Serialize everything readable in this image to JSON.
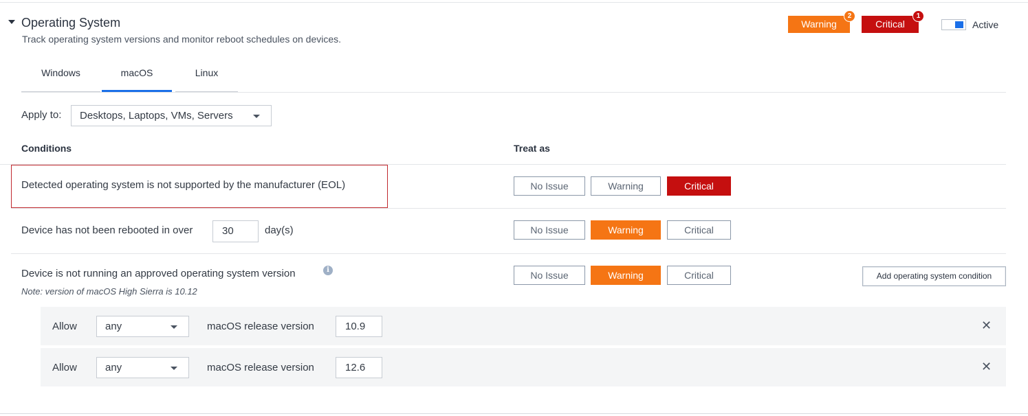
{
  "section": {
    "title": "Operating System",
    "subtitle": "Track operating system versions and monitor reboot schedules on devices.",
    "badges": [
      {
        "label": "Warning",
        "count": "2",
        "color": "#f57514"
      },
      {
        "label": "Critical",
        "count": "1",
        "color": "#c50f0f"
      }
    ],
    "toggle": {
      "label": "Active",
      "on": true
    }
  },
  "tabs": [
    {
      "label": "Windows",
      "selected": false
    },
    {
      "label": "macOS",
      "selected": true
    },
    {
      "label": "Linux",
      "selected": false
    }
  ],
  "apply_to": {
    "label": "Apply to:",
    "value": "Desktops, Laptops, VMs, Servers"
  },
  "columns": {
    "conditions": "Conditions",
    "treat_as": "Treat as"
  },
  "treat_options": [
    "No Issue",
    "Warning",
    "Critical"
  ],
  "conditions": [
    {
      "text": "Detected operating system is not supported by the manufacturer (EOL)",
      "selected": "Critical"
    },
    {
      "text_before": "Device has not been rebooted in over",
      "days": "30",
      "text_after": "day(s)",
      "selected": "Warning"
    },
    {
      "text": "Device is not running an approved operating system version",
      "note": "Note: version of macOS High Sierra is 10.12",
      "selected": "Warning"
    }
  ],
  "add_condition_label": "Add operating system condition",
  "version_rules": [
    {
      "allow": "Allow",
      "operator": "any",
      "field": "macOS release version",
      "version": "10.9"
    },
    {
      "allow": "Allow",
      "operator": "any",
      "field": "macOS release version",
      "version": "12.6"
    }
  ],
  "icons": {
    "collapse": "chevron-down-icon",
    "info": "info-icon",
    "remove": "close-icon"
  },
  "colors": {
    "warning": "#f57514",
    "critical": "#c50f0f",
    "accent": "#1a6fe8"
  }
}
